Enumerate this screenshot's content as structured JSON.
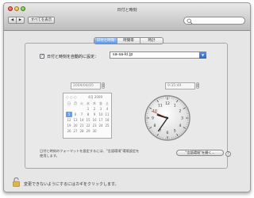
{
  "window": {
    "title": "日付と時刻"
  },
  "toolbar": {
    "show_all_label": "すべてを表示",
    "back_label": "◀",
    "forward_label": "▶",
    "search_placeholder": ""
  },
  "tabs": [
    {
      "label": "日付と時刻",
      "active": true
    },
    {
      "label": "時間帯",
      "active": false
    },
    {
      "label": "時計",
      "active": false
    }
  ],
  "auto": {
    "checked": true,
    "label": "日付と時刻を自動的に設定：",
    "server_value": "sa-sa-ki.jp"
  },
  "date": {
    "value": "2009/04/05"
  },
  "time": {
    "value": "9:35:49"
  },
  "calendar": {
    "month_label": "4月 2009",
    "weekdays": [
      "日",
      "月",
      "火",
      "水",
      "木",
      "金",
      "土"
    ],
    "days": [
      "",
      "",
      "",
      "1",
      "2",
      "3",
      "4",
      "5",
      "6",
      "7",
      "8",
      "9",
      "10",
      "11",
      "12",
      "13",
      "14",
      "15",
      "16",
      "17",
      "18",
      "19",
      "20",
      "21",
      "22",
      "23",
      "24",
      "25",
      "26",
      "27",
      "28",
      "29",
      "30",
      "",
      ""
    ],
    "today": "5"
  },
  "clock": {
    "hour": 9,
    "minute": 35,
    "second": 49
  },
  "footer": {
    "info_line1": "日付と時刻のフォーマットを設定するには、\"言語環境\"環境設定を",
    "info_line2": "使用します。",
    "open_button_label": "\"言語環境\"を開く...",
    "help_label": "?"
  },
  "lock": {
    "text": "変更できないようにするにはカギをクリックします。"
  },
  "colors": {
    "accent": "#5e95e4",
    "window_bg": "#e6e6e6"
  }
}
